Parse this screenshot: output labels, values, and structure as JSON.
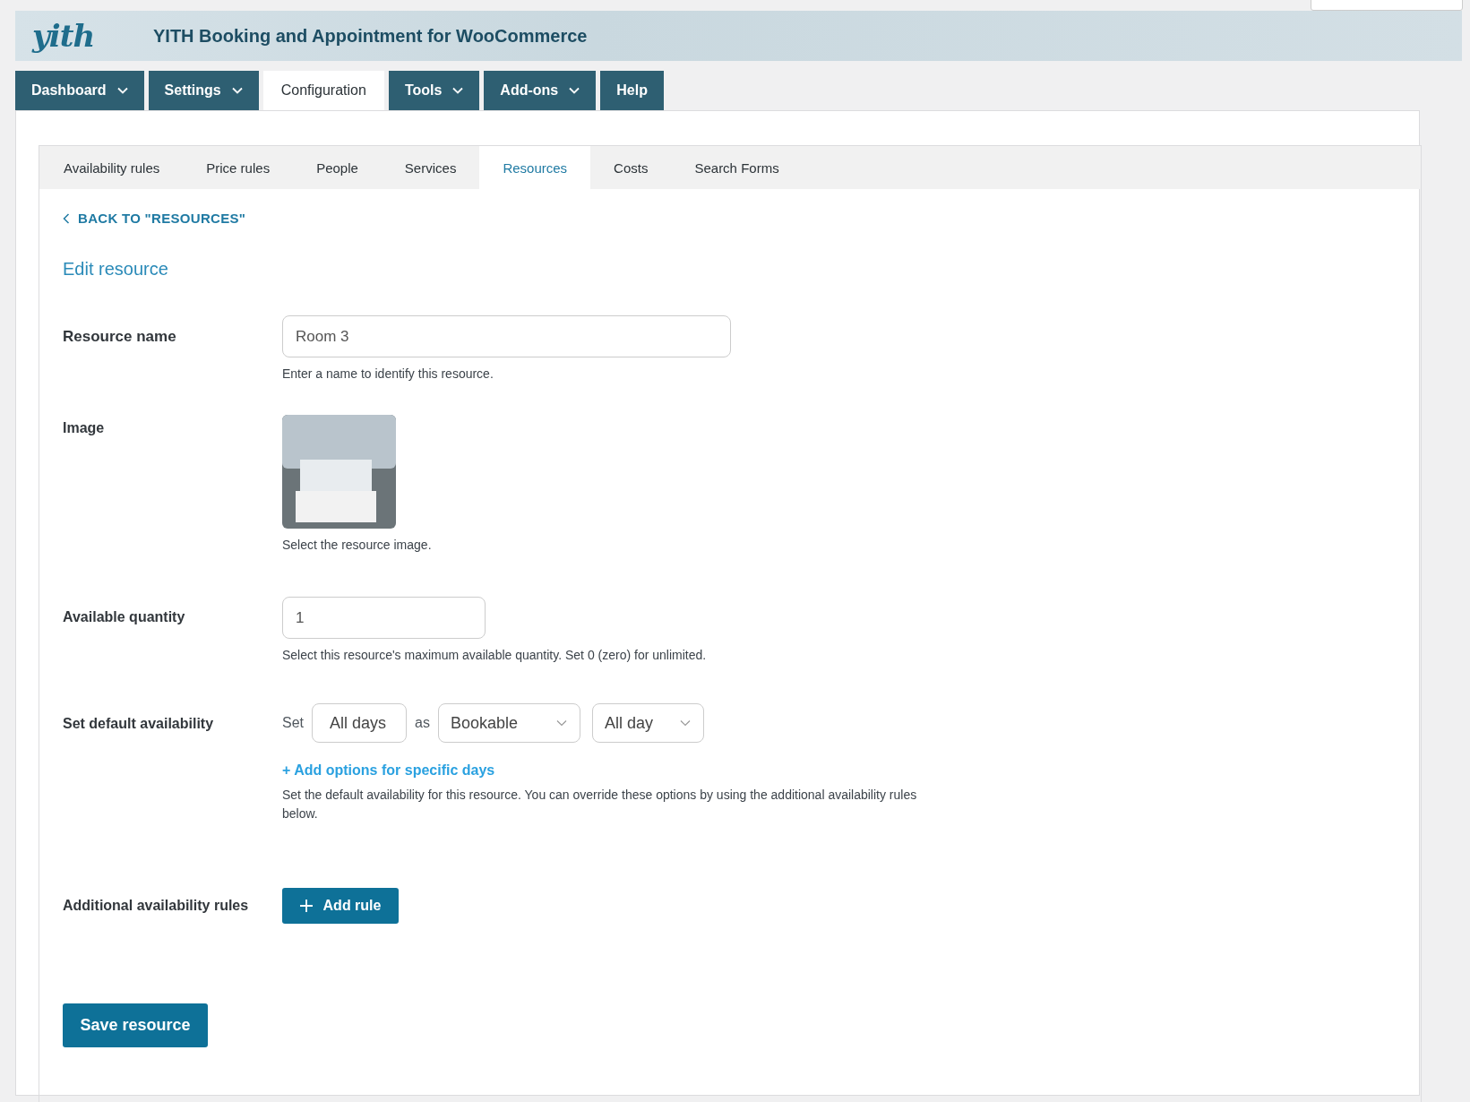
{
  "header": {
    "logo": "yith",
    "title": "YITH Booking and Appointment for WooCommerce"
  },
  "main_tabs": [
    {
      "label": "Dashboard",
      "dropdown": true,
      "selected": false
    },
    {
      "label": "Settings",
      "dropdown": true,
      "selected": false
    },
    {
      "label": "Configuration",
      "dropdown": false,
      "selected": true
    },
    {
      "label": "Tools",
      "dropdown": true,
      "selected": false
    },
    {
      "label": "Add-ons",
      "dropdown": true,
      "selected": false
    },
    {
      "label": "Help",
      "dropdown": false,
      "selected": false
    }
  ],
  "sub_tabs": [
    {
      "label": "Availability rules",
      "selected": false
    },
    {
      "label": "Price rules",
      "selected": false
    },
    {
      "label": "People",
      "selected": false
    },
    {
      "label": "Services",
      "selected": false
    },
    {
      "label": "Resources",
      "selected": true
    },
    {
      "label": "Costs",
      "selected": false
    },
    {
      "label": "Search Forms",
      "selected": false
    }
  ],
  "back_link": "BACK TO \"RESOURCES\"",
  "heading": "Edit resource",
  "fields": [
    {
      "kind": "text",
      "label": "Resource name",
      "value": "Room 3",
      "help": "Enter a name to identify this resource."
    },
    {
      "kind": "image",
      "label": "Image",
      "help": "Select the resource image."
    },
    {
      "kind": "number",
      "label": "Available quantity",
      "value": "1",
      "help": "Select this resource's maximum available quantity. Set 0 (zero) for unlimited."
    },
    {
      "kind": "availability",
      "label": "Set default availability",
      "prefix": "Set",
      "days": "All days",
      "joiner": "as",
      "status": "Bookable",
      "time": "All day",
      "link": "+ Add options for specific days",
      "help": "Set the default availability for this resource. You can override these options by using the additional availability rules below."
    },
    {
      "kind": "button",
      "label": "Additional availability rules",
      "button": "Add rule"
    }
  ],
  "save_button": "Save resource"
}
